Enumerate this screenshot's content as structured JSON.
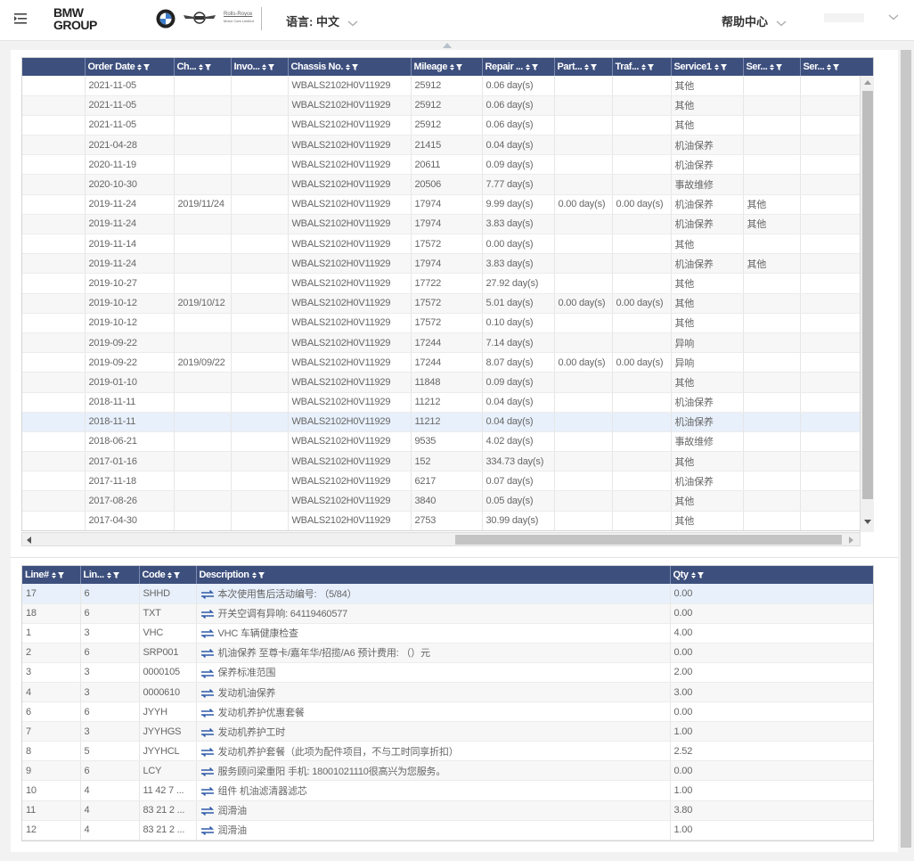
{
  "header": {
    "logo_line1": "BMW",
    "logo_line2": "GROUP",
    "brand_rr_line1": "Rolls-Royce",
    "brand_rr_line2": "Motor Cars Limited",
    "language_label": "语言: 中文",
    "help_label": "帮助中心"
  },
  "orders_grid": {
    "columns": [
      "",
      "Order Date",
      "Ch...",
      "Invo...",
      "Chassis No.",
      "Mileage",
      "Repair ...",
      "Part...",
      "Traf...",
      "Service1",
      "Ser...",
      "Ser..."
    ],
    "rows": [
      [
        "",
        "2021-11-05",
        "",
        "",
        "WBALS2102H0V11929",
        "25912",
        "0.06 day(s)",
        "",
        "",
        "其他",
        "",
        ""
      ],
      [
        "",
        "2021-11-05",
        "",
        "",
        "WBALS2102H0V11929",
        "25912",
        "0.06 day(s)",
        "",
        "",
        "其他",
        "",
        ""
      ],
      [
        "",
        "2021-11-05",
        "",
        "",
        "WBALS2102H0V11929",
        "25912",
        "0.06 day(s)",
        "",
        "",
        "其他",
        "",
        ""
      ],
      [
        "",
        "2021-04-28",
        "",
        "",
        "WBALS2102H0V11929",
        "21415",
        "0.04 day(s)",
        "",
        "",
        "机油保养",
        "",
        ""
      ],
      [
        "",
        "2020-11-19",
        "",
        "",
        "WBALS2102H0V11929",
        "20611",
        "0.09 day(s)",
        "",
        "",
        "机油保养",
        "",
        ""
      ],
      [
        "",
        "2020-10-30",
        "",
        "",
        "WBALS2102H0V11929",
        "20506",
        "7.77 day(s)",
        "",
        "",
        "事故维修",
        "",
        ""
      ],
      [
        "",
        "2019-11-24",
        "2019/11/24",
        "",
        "WBALS2102H0V11929",
        "17974",
        "9.99 day(s)",
        "0.00 day(s)",
        "0.00 day(s)",
        "机油保养",
        "其他",
        ""
      ],
      [
        "",
        "2019-11-24",
        "",
        "",
        "WBALS2102H0V11929",
        "17974",
        "3.83 day(s)",
        "",
        "",
        "机油保养",
        "其他",
        ""
      ],
      [
        "",
        "2019-11-14",
        "",
        "",
        "WBALS2102H0V11929",
        "17572",
        "0.00 day(s)",
        "",
        "",
        "其他",
        "",
        ""
      ],
      [
        "",
        "2019-11-24",
        "",
        "",
        "WBALS2102H0V11929",
        "17974",
        "3.83 day(s)",
        "",
        "",
        "机油保养",
        "其他",
        ""
      ],
      [
        "",
        "2019-10-27",
        "",
        "",
        "WBALS2102H0V11929",
        "17722",
        "27.92 day(s)",
        "",
        "",
        "其他",
        "",
        ""
      ],
      [
        "",
        "2019-10-12",
        "2019/10/12",
        "",
        "WBALS2102H0V11929",
        "17572",
        "5.01 day(s)",
        "0.00 day(s)",
        "0.00 day(s)",
        "其他",
        "",
        ""
      ],
      [
        "",
        "2019-10-12",
        "",
        "",
        "WBALS2102H0V11929",
        "17572",
        "0.10 day(s)",
        "",
        "",
        "其他",
        "",
        ""
      ],
      [
        "",
        "2019-09-22",
        "",
        "",
        "WBALS2102H0V11929",
        "17244",
        "7.14 day(s)",
        "",
        "",
        "异响",
        "",
        ""
      ],
      [
        "",
        "2019-09-22",
        "2019/09/22",
        "",
        "WBALS2102H0V11929",
        "17244",
        "8.07 day(s)",
        "0.00 day(s)",
        "0.00 day(s)",
        "异响",
        "",
        ""
      ],
      [
        "",
        "2019-01-10",
        "",
        "",
        "WBALS2102H0V11929",
        "11848",
        "0.09 day(s)",
        "",
        "",
        "其他",
        "",
        ""
      ],
      [
        "",
        "2018-11-11",
        "",
        "",
        "WBALS2102H0V11929",
        "11212",
        "0.04 day(s)",
        "",
        "",
        "机油保养",
        "",
        ""
      ],
      [
        "",
        "2018-11-11",
        "",
        "",
        "WBALS2102H0V11929",
        "11212",
        "0.04 day(s)",
        "",
        "",
        "机油保养",
        "",
        ""
      ],
      [
        "",
        "2018-06-21",
        "",
        "",
        "WBALS2102H0V11929",
        "9535",
        "4.02 day(s)",
        "",
        "",
        "事故维修",
        "",
        ""
      ],
      [
        "",
        "2017-01-16",
        "",
        "",
        "WBALS2102H0V11929",
        "152",
        "334.73 day(s)",
        "",
        "",
        "其他",
        "",
        ""
      ],
      [
        "",
        "2017-11-18",
        "",
        "",
        "WBALS2102H0V11929",
        "6217",
        "0.07 day(s)",
        "",
        "",
        "机油保养",
        "",
        ""
      ],
      [
        "",
        "2017-08-26",
        "",
        "",
        "WBALS2102H0V11929",
        "3840",
        "0.05 day(s)",
        "",
        "",
        "其他",
        "",
        ""
      ],
      [
        "",
        "2017-04-30",
        "",
        "",
        "WBALS2102H0V11929",
        "2753",
        "30.99 day(s)",
        "",
        "",
        "其他",
        "",
        ""
      ]
    ],
    "selected_row": 17
  },
  "lines_grid": {
    "columns": [
      "Line#",
      "Lin...",
      "Code",
      "Description",
      "Qty"
    ],
    "rows": [
      [
        "17",
        "6",
        "SHHD",
        "本次使用售后活动编号: （5/84）",
        "0.00"
      ],
      [
        "18",
        "6",
        "TXT",
        "开关空调有异响: 64119460577",
        "0.00"
      ],
      [
        "1",
        "3",
        "VHC",
        "VHC 车辆健康检查",
        "4.00"
      ],
      [
        "2",
        "6",
        "SRP001",
        "机油保养 至尊卡/嘉年华/招揽/A6 预计费用: （）元",
        "0.00"
      ],
      [
        "3",
        "3",
        "0000105",
        "保养标准范围",
        "2.00"
      ],
      [
        "4",
        "3",
        "0000610",
        "发动机油保养",
        "3.00"
      ],
      [
        "6",
        "6",
        "JYYH",
        "发动机养护优惠套餐",
        "0.00"
      ],
      [
        "7",
        "3",
        "JYYHGS",
        "发动机养护工时",
        "1.00"
      ],
      [
        "8",
        "5",
        "JYYHCL",
        "发动机养护套餐（此项为配件项目，不与工时同享折扣）",
        "2.52"
      ],
      [
        "9",
        "6",
        "LCY",
        "服务顾问梁重阳 手机: 18001021110很高兴为您服务。",
        "0.00"
      ],
      [
        "10",
        "4",
        "11 42 7 ...",
        "组件 机油滤清器滤芯",
        "1.00"
      ],
      [
        "11",
        "4",
        "83 21 2 ...",
        "润滑油",
        "3.80"
      ],
      [
        "12",
        "4",
        "83 21 2 ...",
        "润滑油",
        "1.00"
      ]
    ],
    "selected_row": 0
  },
  "icons": {
    "menu": "menu-icon",
    "sort_filter": "sort-filter-icon",
    "swap": "swap-arrows-icon"
  },
  "colors": {
    "header_bg": "#3d4f7d",
    "selected_row": "#e8f0fb",
    "swap_icon": "#2f5aa8"
  }
}
